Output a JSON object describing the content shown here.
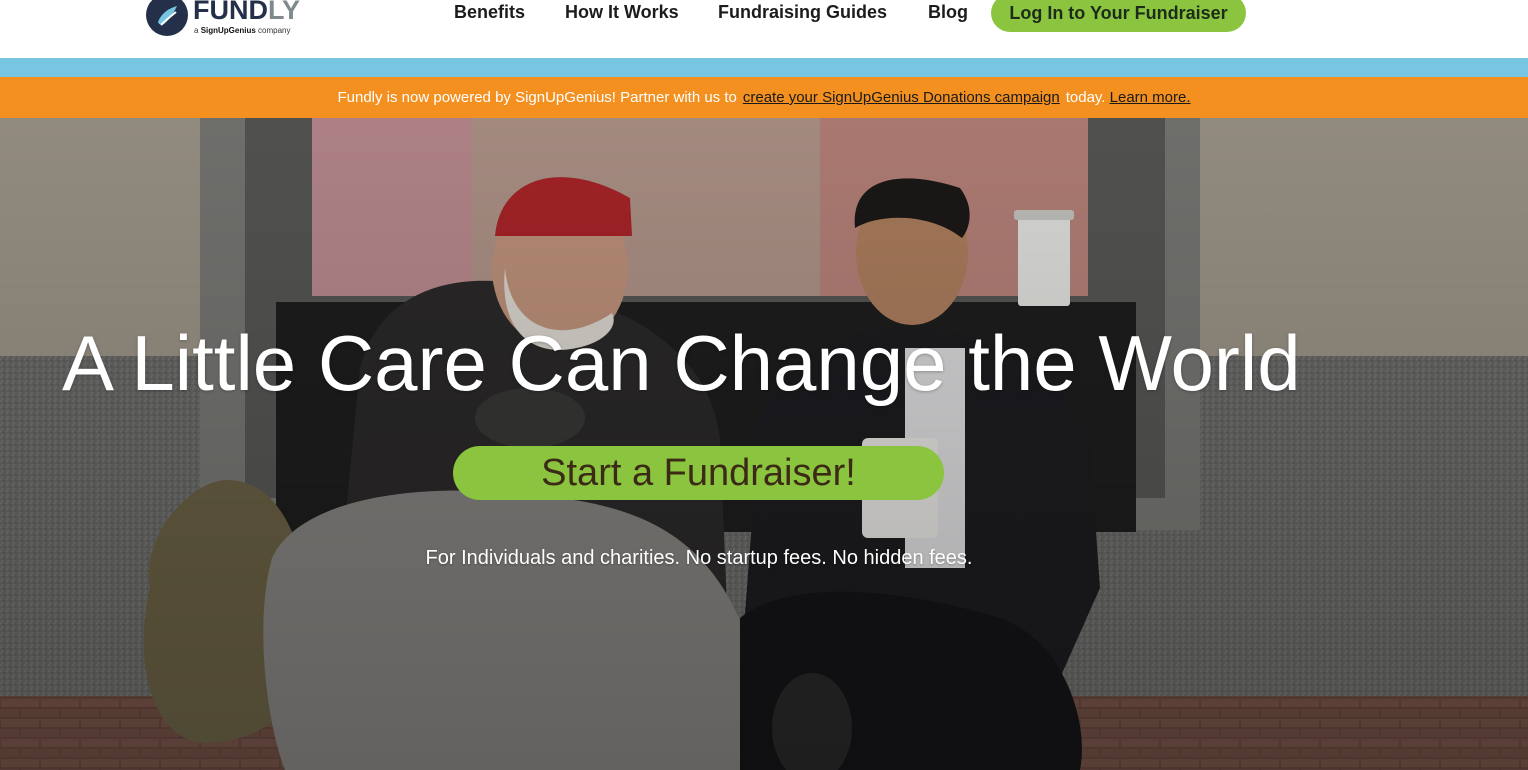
{
  "header": {
    "logo": {
      "word_main": "FUND",
      "word_tail": "LY",
      "tagline_prefix": "a",
      "tagline_brand": "SignUpGenius",
      "tagline_suffix": "company"
    },
    "nav": [
      {
        "label": "Benefits"
      },
      {
        "label": "How It Works"
      },
      {
        "label": "Fundraising Guides"
      },
      {
        "label": "Blog"
      }
    ],
    "login_label": "Log In to Your Fundraiser"
  },
  "announcement": {
    "text_before": "Fundly is now powered by SignUpGenius! Partner with us to",
    "link_campaign": "create your SignUpGenius Donations campaign",
    "text_after": "today.",
    "link_learn": "Learn more."
  },
  "hero": {
    "title": "A Little Care Can Change the World",
    "cta_label": "Start a Fundraiser!",
    "subtitle": "For Individuals and charities. No startup fees. No hidden fees."
  },
  "colors": {
    "accent_green": "#8bc53f",
    "banner_orange": "#f39020",
    "band_blue": "#78c5e2",
    "logo_navy": "#24304a"
  }
}
